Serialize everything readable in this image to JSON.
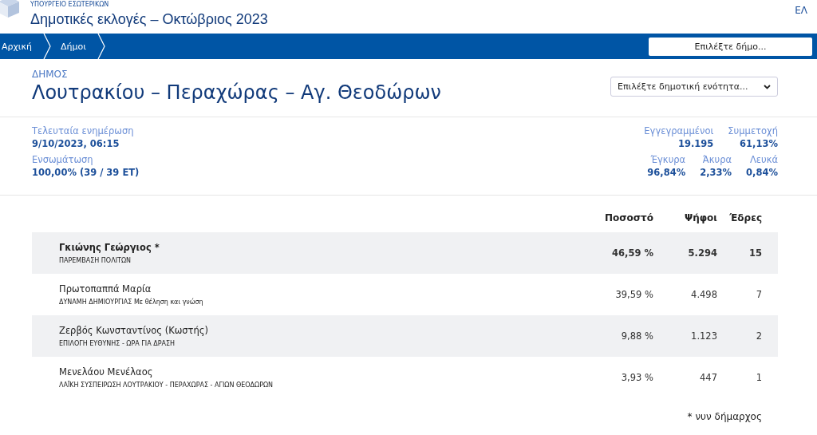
{
  "header": {
    "ministry": "ΥΠΟΥΡΓΕΙΟ ΕΣΩΤΕΡΙΚΩΝ",
    "title": "Δημοτικές εκλογές – Οκτώβριος 2023",
    "language": "ΕΛ"
  },
  "breadcrumbs": [
    "Αρχική",
    "Δήμοι"
  ],
  "municipality_select": {
    "placeholder": "Επιλέξτε δήμο..."
  },
  "municipality": {
    "label": "ΔΗΜΟΣ",
    "name": "Λουτρακίου – Περαχώρας – Αγ. Θεοδώρων"
  },
  "unit_select": {
    "value": "Επιλέξτε δημοτική ενότητα..."
  },
  "stats_left": [
    {
      "label": "Τελευταία ενημέρωση",
      "value": "9/10/2023, 06:15"
    },
    {
      "label": "Ενσωμάτωση",
      "value": "100,00% (39 / 39 ΕΤ)"
    }
  ],
  "stats_right": [
    [
      {
        "label": "Εγγεγραμμένοι",
        "value": "19.195"
      },
      {
        "label": "Συμμετοχή",
        "value": "61,13%"
      }
    ],
    [
      {
        "label": "Έγκυρα",
        "value": "96,84%"
      },
      {
        "label": "Άκυρα",
        "value": "2,33%"
      },
      {
        "label": "Λευκά",
        "value": "0,84%"
      }
    ]
  ],
  "table": {
    "columns": [
      "Ποσοστό",
      "Ψήφοι",
      "Έδρες"
    ],
    "rows": [
      {
        "name": "Γκιώνης Γεώργιος *",
        "party": "ΠΑΡΕΜΒΑΣΗ ΠΟΛΙΤΩΝ",
        "percent": "46,59 %",
        "votes": "5.294",
        "seats": "15",
        "leading": true
      },
      {
        "name": "Πρωτοπαππά Μαρία",
        "party": "ΔΥΝΑΜΗ ΔΗΜΙΟΥΡΓΙΑΣ Με θέληση και γνώση",
        "percent": "39,59 %",
        "votes": "4.498",
        "seats": "7",
        "leading": false
      },
      {
        "name": "Ζερβός Κωνσταντίνος (Κωστής)",
        "party": "ΕΠΙΛΟΓΗ ΕΥΘΥΝΗΣ - ΩΡΑ ΓΙΑ ΔΡΑΣΗ",
        "percent": "9,88 %",
        "votes": "1.123",
        "seats": "2",
        "leading": false
      },
      {
        "name": "Μενελάου Μενέλαος",
        "party": "ΛΑΪΚΗ ΣΥΣΠΕΙΡΩΣΗ ΛΟΥΤΡΑΚΙΟΥ - ΠΕΡΑΧΩΡΑΣ - ΑΓΙΩΝ ΘΕΟΔΩΡΩΝ",
        "percent": "3,93 %",
        "votes": "447",
        "seats": "1",
        "leading": false
      }
    ]
  },
  "footnote": "* νυν δήμαρχος"
}
